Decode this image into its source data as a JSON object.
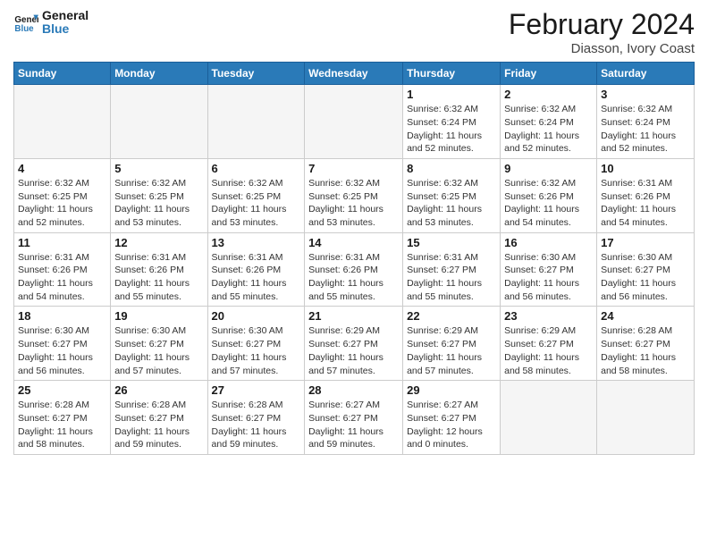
{
  "logo": {
    "line1": "General",
    "line2": "Blue"
  },
  "title": "February 2024",
  "subtitle": "Diasson, Ivory Coast",
  "days_header": [
    "Sunday",
    "Monday",
    "Tuesday",
    "Wednesday",
    "Thursday",
    "Friday",
    "Saturday"
  ],
  "weeks": [
    [
      {
        "day": "",
        "info": ""
      },
      {
        "day": "",
        "info": ""
      },
      {
        "day": "",
        "info": ""
      },
      {
        "day": "",
        "info": ""
      },
      {
        "day": "1",
        "info": "Sunrise: 6:32 AM\nSunset: 6:24 PM\nDaylight: 11 hours\nand 52 minutes."
      },
      {
        "day": "2",
        "info": "Sunrise: 6:32 AM\nSunset: 6:24 PM\nDaylight: 11 hours\nand 52 minutes."
      },
      {
        "day": "3",
        "info": "Sunrise: 6:32 AM\nSunset: 6:24 PM\nDaylight: 11 hours\nand 52 minutes."
      }
    ],
    [
      {
        "day": "4",
        "info": "Sunrise: 6:32 AM\nSunset: 6:25 PM\nDaylight: 11 hours\nand 52 minutes."
      },
      {
        "day": "5",
        "info": "Sunrise: 6:32 AM\nSunset: 6:25 PM\nDaylight: 11 hours\nand 53 minutes."
      },
      {
        "day": "6",
        "info": "Sunrise: 6:32 AM\nSunset: 6:25 PM\nDaylight: 11 hours\nand 53 minutes."
      },
      {
        "day": "7",
        "info": "Sunrise: 6:32 AM\nSunset: 6:25 PM\nDaylight: 11 hours\nand 53 minutes."
      },
      {
        "day": "8",
        "info": "Sunrise: 6:32 AM\nSunset: 6:25 PM\nDaylight: 11 hours\nand 53 minutes."
      },
      {
        "day": "9",
        "info": "Sunrise: 6:32 AM\nSunset: 6:26 PM\nDaylight: 11 hours\nand 54 minutes."
      },
      {
        "day": "10",
        "info": "Sunrise: 6:31 AM\nSunset: 6:26 PM\nDaylight: 11 hours\nand 54 minutes."
      }
    ],
    [
      {
        "day": "11",
        "info": "Sunrise: 6:31 AM\nSunset: 6:26 PM\nDaylight: 11 hours\nand 54 minutes."
      },
      {
        "day": "12",
        "info": "Sunrise: 6:31 AM\nSunset: 6:26 PM\nDaylight: 11 hours\nand 55 minutes."
      },
      {
        "day": "13",
        "info": "Sunrise: 6:31 AM\nSunset: 6:26 PM\nDaylight: 11 hours\nand 55 minutes."
      },
      {
        "day": "14",
        "info": "Sunrise: 6:31 AM\nSunset: 6:26 PM\nDaylight: 11 hours\nand 55 minutes."
      },
      {
        "day": "15",
        "info": "Sunrise: 6:31 AM\nSunset: 6:27 PM\nDaylight: 11 hours\nand 55 minutes."
      },
      {
        "day": "16",
        "info": "Sunrise: 6:30 AM\nSunset: 6:27 PM\nDaylight: 11 hours\nand 56 minutes."
      },
      {
        "day": "17",
        "info": "Sunrise: 6:30 AM\nSunset: 6:27 PM\nDaylight: 11 hours\nand 56 minutes."
      }
    ],
    [
      {
        "day": "18",
        "info": "Sunrise: 6:30 AM\nSunset: 6:27 PM\nDaylight: 11 hours\nand 56 minutes."
      },
      {
        "day": "19",
        "info": "Sunrise: 6:30 AM\nSunset: 6:27 PM\nDaylight: 11 hours\nand 57 minutes."
      },
      {
        "day": "20",
        "info": "Sunrise: 6:30 AM\nSunset: 6:27 PM\nDaylight: 11 hours\nand 57 minutes."
      },
      {
        "day": "21",
        "info": "Sunrise: 6:29 AM\nSunset: 6:27 PM\nDaylight: 11 hours\nand 57 minutes."
      },
      {
        "day": "22",
        "info": "Sunrise: 6:29 AM\nSunset: 6:27 PM\nDaylight: 11 hours\nand 57 minutes."
      },
      {
        "day": "23",
        "info": "Sunrise: 6:29 AM\nSunset: 6:27 PM\nDaylight: 11 hours\nand 58 minutes."
      },
      {
        "day": "24",
        "info": "Sunrise: 6:28 AM\nSunset: 6:27 PM\nDaylight: 11 hours\nand 58 minutes."
      }
    ],
    [
      {
        "day": "25",
        "info": "Sunrise: 6:28 AM\nSunset: 6:27 PM\nDaylight: 11 hours\nand 58 minutes."
      },
      {
        "day": "26",
        "info": "Sunrise: 6:28 AM\nSunset: 6:27 PM\nDaylight: 11 hours\nand 59 minutes."
      },
      {
        "day": "27",
        "info": "Sunrise: 6:28 AM\nSunset: 6:27 PM\nDaylight: 11 hours\nand 59 minutes."
      },
      {
        "day": "28",
        "info": "Sunrise: 6:27 AM\nSunset: 6:27 PM\nDaylight: 11 hours\nand 59 minutes."
      },
      {
        "day": "29",
        "info": "Sunrise: 6:27 AM\nSunset: 6:27 PM\nDaylight: 12 hours\nand 0 minutes."
      },
      {
        "day": "",
        "info": ""
      },
      {
        "day": "",
        "info": ""
      }
    ]
  ]
}
